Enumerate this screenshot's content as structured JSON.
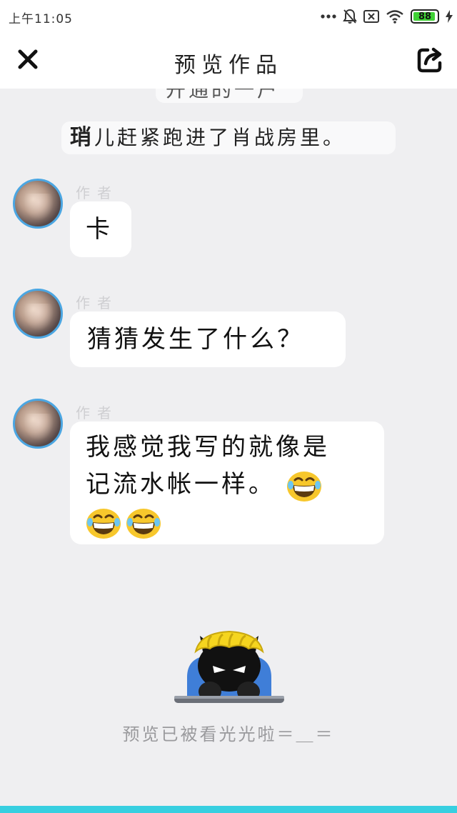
{
  "status_bar": {
    "time": "上午11:05",
    "battery_level": "88",
    "icons": [
      "more-dots-icon",
      "bell-muted-icon",
      "sim-off-icon",
      "wifi-icon",
      "battery-icon",
      "charging-icon"
    ]
  },
  "header": {
    "title": "预览作品",
    "close_icon": "close-icon",
    "share_icon": "share-icon"
  },
  "story": {
    "partial_narration": "开通的一户",
    "narration_first_char": "琑",
    "narration_rest": "儿赶紧跑进了肖战房里。",
    "messages": [
      {
        "author_label": "作者",
        "text": "卡",
        "emoji_count": 0
      },
      {
        "author_label": "作者",
        "text": "猜猜发生了什么？",
        "emoji_count": 0
      },
      {
        "author_label": "作者",
        "line1": "我感觉我写的就像是",
        "line2": "记流水帐一样。",
        "emoji_after_line2": "grinning-face-icon",
        "emoji_line3": [
          "grinning-face-icon",
          "grinning-face-icon"
        ]
      }
    ]
  },
  "footer": {
    "caption": "预览已被看光光啦＝＿＝",
    "mascot_icon": "peeking-mascot-icon"
  },
  "colors": {
    "background": "#efeff1",
    "bubble": "#ffffff",
    "avatar_border": "#4ba6e2",
    "bottom_bar": "#37cfe0",
    "battery_green": "#3fd135"
  }
}
